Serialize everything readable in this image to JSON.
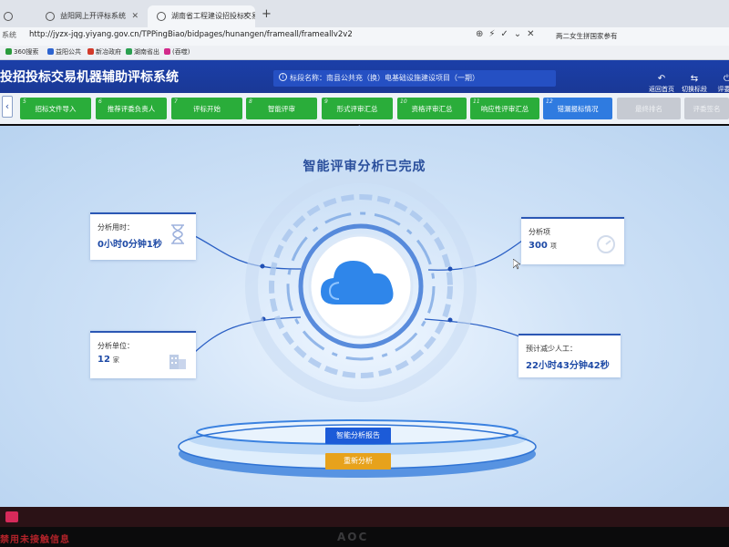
{
  "browser": {
    "tabs": [
      {
        "title": "",
        "active": false
      },
      {
        "title": "益阳网上开评标系统",
        "active": false
      },
      {
        "title": "湖南省工程建设招投标交易机",
        "active": true
      }
    ],
    "new_tab": "+",
    "url": "http://jyzx-jqg.yiyang.gov.cn/TPPingBiao/bidpages/hunangen/frameall/frameallv2v2",
    "url_prefix": "系统",
    "search_text": "两二女生拼国家参有",
    "bookmarks": [
      "360搜索",
      "益阳公共",
      "新冶政府",
      "湖南省出",
      "(吞噬)"
    ]
  },
  "app": {
    "title": "投招投标交易机器辅助评标系统",
    "project_label": "标段名称：南县公共充（换）电基础设施建设项目（一期）",
    "header_buttons": [
      {
        "icon": "return-icon",
        "glyph": "↶",
        "label": "返回首页"
      },
      {
        "icon": "switch-icon",
        "glyph": "⇆",
        "label": "切换标段"
      },
      {
        "icon": "exit-icon",
        "glyph": "⏻",
        "label": "评委退"
      }
    ]
  },
  "steps": [
    {
      "num": "5",
      "label": "招标文件导入",
      "state": "done"
    },
    {
      "num": "6",
      "label": "推荐评委负责人",
      "state": "done"
    },
    {
      "num": "7",
      "label": "评标开始",
      "state": "done"
    },
    {
      "num": "8",
      "label": "智能评审",
      "state": "done"
    },
    {
      "num": "9",
      "label": "形式评审汇总",
      "state": "done"
    },
    {
      "num": "10",
      "label": "资格评审汇总",
      "state": "done"
    },
    {
      "num": "11",
      "label": "响应性评审汇总",
      "state": "done"
    },
    {
      "num": "12",
      "label": "错漏报标情况",
      "state": "current"
    },
    {
      "num": "",
      "label": "最终排名",
      "state": "pending"
    },
    {
      "num": "",
      "label": "评委签名",
      "state": "pending"
    }
  ],
  "main": {
    "title": "智能评审分析已完成",
    "cards": {
      "time": {
        "label": "分析用时：",
        "value": "0小时0分钟1秒",
        "icon": "hourglass-icon"
      },
      "units": {
        "label": "分析单位：",
        "value": "12",
        "unit": "家",
        "icon": "building-icon"
      },
      "items": {
        "label": "分析项",
        "value": "300",
        "unit": "项",
        "icon": "gauge-icon"
      },
      "saved": {
        "label": "预计减少人工：",
        "value": "22小时43分钟42秒",
        "icon": "people-icon"
      }
    },
    "center_icon": "cloud-icon",
    "report_button": "智能分析报告",
    "retry_button": "重新分析"
  },
  "bezel": {
    "sticker": "禁用未接触信息",
    "logo": "AOC"
  },
  "colors": {
    "header_blue": "#1b3fa8",
    "step_green": "#2aad3a",
    "step_blue": "#2f7be0",
    "step_gray": "#c6cad2",
    "accent_value": "#1e4aa6",
    "retry_orange": "#e7a21c"
  }
}
